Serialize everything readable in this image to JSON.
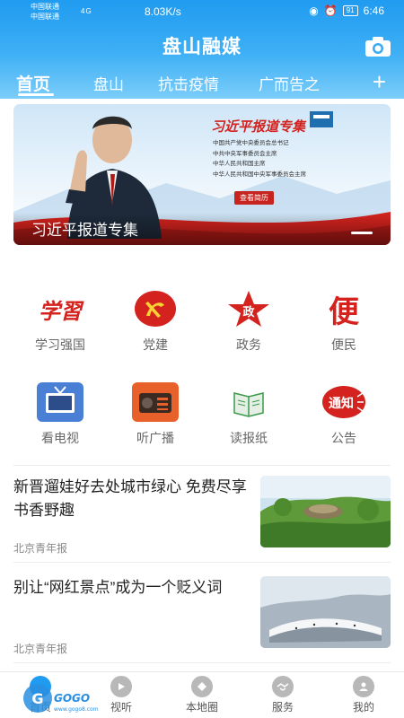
{
  "status": {
    "carrier1": "中国联通",
    "carrier2": "中国联通",
    "network": "4G",
    "speed": "8.03K/s",
    "battery": "91",
    "time": "6:46"
  },
  "header": {
    "title": "盘山融媒",
    "camera_icon": "camera-icon"
  },
  "tabs": [
    "首页",
    "盘山",
    "抗击疫情",
    "广而告之"
  ],
  "active_tab": "首页",
  "banner": {
    "title": "习近平报道专集",
    "lines": [
      "中国共产党中央委员会总书记",
      "中共中央军事委员会主席",
      "中华人民共和国主席",
      "中华人民共和国中央军事委员会主席"
    ],
    "button": "查看简历",
    "caption": "习近平报道专集"
  },
  "grid": [
    {
      "label": "学习强国",
      "icon": "xuexi-icon",
      "color": "#d4231e"
    },
    {
      "label": "党建",
      "icon": "party-emblem-icon",
      "color": "#d4231e"
    },
    {
      "label": "政务",
      "icon": "zheng-star-icon",
      "color": "#d4231e"
    },
    {
      "label": "便民",
      "icon": "bian-icon",
      "color": "#d4231e"
    },
    {
      "label": "看电视",
      "icon": "tv-icon",
      "color": "#4a7fd6"
    },
    {
      "label": "听广播",
      "icon": "radio-icon",
      "color": "#e8602a"
    },
    {
      "label": "读报纸",
      "icon": "newspaper-icon",
      "color": "#3a9a4a"
    },
    {
      "label": "公告",
      "icon": "notice-icon",
      "color": "#d4231e"
    }
  ],
  "news": [
    {
      "title": "新晋遛娃好去处城市绿心 免费尽享书香野趣",
      "source": "北京青年报"
    },
    {
      "title": "别让“网红景点”成为一个贬义词",
      "source": "北京青年报"
    }
  ],
  "bottom_nav": [
    {
      "label": "首页",
      "icon": "home-icon"
    },
    {
      "label": "视听",
      "icon": "play-icon"
    },
    {
      "label": "本地圈",
      "icon": "circle-icon"
    },
    {
      "label": "服务",
      "icon": "handshake-icon"
    },
    {
      "label": "我的",
      "icon": "user-icon"
    }
  ],
  "colors": {
    "brand": "#1f9bf0",
    "accent_red": "#d4231e"
  }
}
